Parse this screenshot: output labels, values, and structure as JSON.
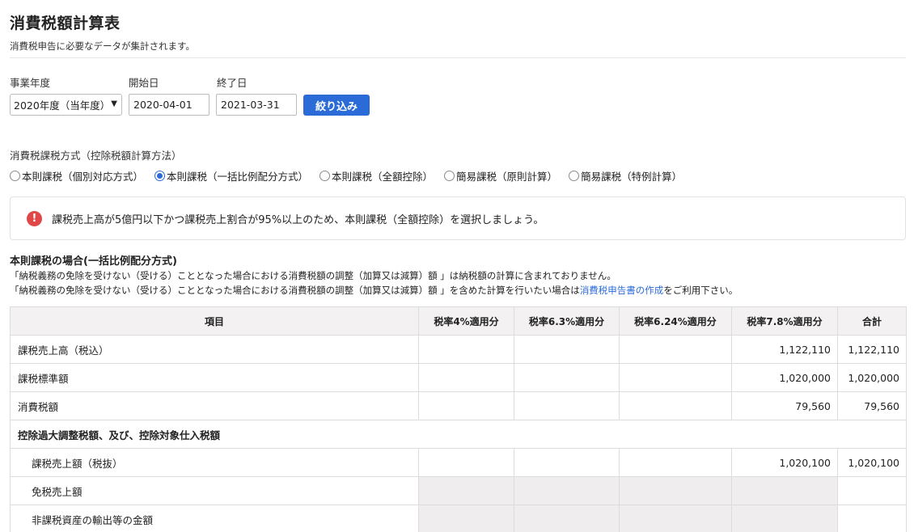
{
  "page": {
    "title": "消費税額計算表",
    "subtitle": "消費税申告に必要なデータが集計されます。"
  },
  "filters": {
    "year_label": "事業年度",
    "year_value": "2020年度（当年度）",
    "start_label": "開始日",
    "start_value": "2020-04-01",
    "end_label": "終了日",
    "end_value": "2021-03-31",
    "submit_label": "絞り込み"
  },
  "method": {
    "label": "消費税課税方式（控除税額計算方法）",
    "options": [
      {
        "label": "本則課税（個別対応方式）",
        "checked": false
      },
      {
        "label": "本則課税（一括比例配分方式）",
        "checked": true
      },
      {
        "label": "本則課税（全額控除）",
        "checked": false
      },
      {
        "label": "簡易課税（原則計算）",
        "checked": false
      },
      {
        "label": "簡易課税（特例計算）",
        "checked": false
      }
    ]
  },
  "alert": {
    "icon": "exclamation-icon",
    "color": "#e04848",
    "text": "課税売上高が5億円以下かつ課税売上割合が95%以上のため、本則課税（全額控除）を選択しましょう。"
  },
  "section": {
    "title": "本則課税の場合(一括比例配分方式)",
    "note1": "「納税義務の免除を受けない（受ける）こととなった場合における消費税額の調整（加算又は減算）額 」は納税額の計算に含まれておりません。",
    "note2_prefix": "「納税義務の免除を受けない（受ける）こととなった場合における消費税額の調整（加算又は減算）額 」を含めた計算を行いたい場合は",
    "note2_link": "消費税申告書の作成",
    "note2_suffix": "をご利用下さい。"
  },
  "table": {
    "headers": [
      "項目",
      "税率4%適用分",
      "税率6.3%適用分",
      "税率6.24%適用分",
      "税率7.8%適用分",
      "合計"
    ],
    "rows": [
      {
        "label": "課税売上高（税込）",
        "cells": [
          "",
          "",
          "",
          "1,122,110",
          "1,122,110"
        ]
      },
      {
        "label": "課税標準額",
        "cells": [
          "",
          "",
          "",
          "1,020,000",
          "1,020,000"
        ]
      },
      {
        "label": "消費税額",
        "cells": [
          "",
          "",
          "",
          "79,560",
          "79,560"
        ]
      }
    ],
    "group_label": "控除過大調整税額、及び、控除対象仕入税額",
    "sub_rows": [
      {
        "label": "課税売上額（税抜）",
        "cells": [
          "",
          "",
          "",
          "1,020,100",
          "1,020,100"
        ]
      },
      {
        "label": "免税売上額",
        "cells": [
          "",
          "",
          "",
          "",
          ""
        ]
      },
      {
        "label": "非課税資産の輸出等の金額",
        "cells": [
          "",
          "",
          "",
          "",
          ""
        ]
      }
    ]
  }
}
